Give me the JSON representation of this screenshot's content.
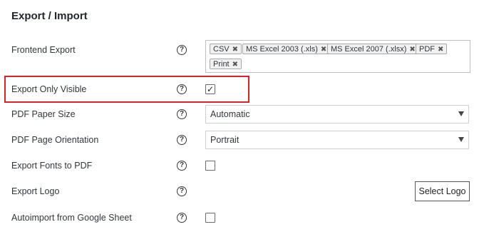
{
  "section": {
    "title": "Export / Import"
  },
  "rows": {
    "frontend_export": {
      "label": "Frontend Export",
      "tags": [
        "CSV",
        "MS Excel 2003 (.xls)",
        "MS Excel 2007 (.xlsx)",
        "PDF",
        "Print"
      ]
    },
    "export_only_visible": {
      "label": "Export Only Visible",
      "checked": true,
      "check_glyph": "✓"
    },
    "pdf_paper_size": {
      "label": "PDF Paper Size",
      "value": "Automatic"
    },
    "pdf_page_orientation": {
      "label": "PDF Page Orientation",
      "value": "Portrait"
    },
    "export_fonts_to_pdf": {
      "label": "Export Fonts to PDF",
      "checked": false
    },
    "export_logo": {
      "label": "Export Logo",
      "button": "Select Logo"
    },
    "autoimport_google_sheet": {
      "label": "Autoimport from Google Sheet",
      "checked": false
    }
  },
  "help_glyph": "?",
  "remove_glyph": "✖",
  "colors": {
    "highlight": "#d9242b",
    "text": "#32373c"
  }
}
